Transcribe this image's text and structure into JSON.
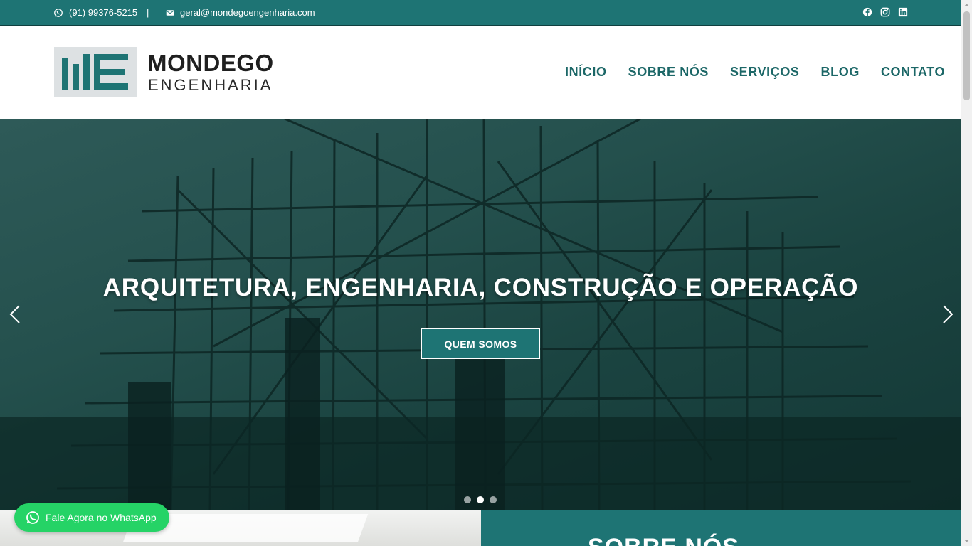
{
  "topbar": {
    "phone": "(91) 99376-5215",
    "separator": "|",
    "email": "geral@mondegoengenharia.com",
    "social_icons": [
      "facebook-icon",
      "instagram-icon",
      "linkedin-icon"
    ]
  },
  "header": {
    "logo_line1": "MONDEGO",
    "logo_line2": "ENGENHARIA",
    "nav": [
      "INÍCIO",
      "SOBRE NÓS",
      "SERVIÇOS",
      "BLOG",
      "CONTATO"
    ]
  },
  "hero": {
    "title": "ARQUITETURA, ENGENHARIA, CONSTRUÇÃO E OPERAÇÃO",
    "button_label": "QUEM SOMOS",
    "slide_count": 3,
    "active_slide": 2
  },
  "about": {
    "heading": "SOBRE NÓS"
  },
  "whatsapp_button": {
    "label": "Fale Agora no WhatsApp"
  },
  "colors": {
    "brand_teal": "#1e7474",
    "whatsapp_green": "#25d366",
    "nav_text": "#1c6767"
  }
}
